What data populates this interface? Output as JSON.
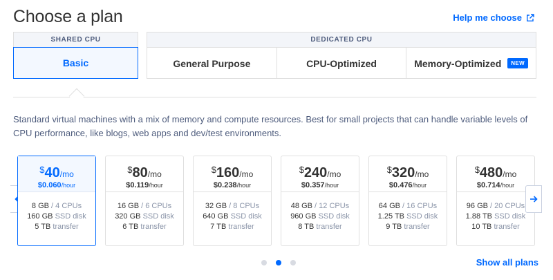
{
  "header": {
    "title": "Choose a plan",
    "help_link": "Help me choose"
  },
  "cpu_groups": {
    "shared": {
      "label": "Shared CPU",
      "tabs": [
        {
          "label": "Basic",
          "selected": true
        }
      ]
    },
    "dedicated": {
      "label": "Dedicated CPU",
      "tabs": [
        {
          "label": "General Purpose"
        },
        {
          "label": "CPU-Optimized"
        },
        {
          "label": "Memory-Optimized",
          "badge": "NEW"
        }
      ]
    }
  },
  "description": "Standard virtual machines with a mix of memory and compute resources. Best for small projects that can handle variable levels of CPU performance, like blogs, web apps and dev/test environments.",
  "plans": [
    {
      "currency": "$",
      "price": "40",
      "per_month": "/mo",
      "hourly": "$0.060",
      "per_hour": "/hour",
      "memory": "8 GB",
      "cpus": "4 CPUs",
      "disk_size": "160 GB",
      "disk_label": "SSD disk",
      "transfer": "5 TB",
      "transfer_label": "transfer",
      "selected": true
    },
    {
      "currency": "$",
      "price": "80",
      "per_month": "/mo",
      "hourly": "$0.119",
      "per_hour": "/hour",
      "memory": "16 GB",
      "cpus": "6 CPUs",
      "disk_size": "320 GB",
      "disk_label": "SSD disk",
      "transfer": "6 TB",
      "transfer_label": "transfer"
    },
    {
      "currency": "$",
      "price": "160",
      "per_month": "/mo",
      "hourly": "$0.238",
      "per_hour": "/hour",
      "memory": "32 GB",
      "cpus": "8 CPUs",
      "disk_size": "640 GB",
      "disk_label": "SSD disk",
      "transfer": "7 TB",
      "transfer_label": "transfer"
    },
    {
      "currency": "$",
      "price": "240",
      "per_month": "/mo",
      "hourly": "$0.357",
      "per_hour": "/hour",
      "memory": "48 GB",
      "cpus": "12 CPUs",
      "disk_size": "960 GB",
      "disk_label": "SSD disk",
      "transfer": "8 TB",
      "transfer_label": "transfer"
    },
    {
      "currency": "$",
      "price": "320",
      "per_month": "/mo",
      "hourly": "$0.476",
      "per_hour": "/hour",
      "memory": "64 GB",
      "cpus": "16 CPUs",
      "disk_size": "1.25 TB",
      "disk_label": "SSD disk",
      "transfer": "9 TB",
      "transfer_label": "transfer"
    },
    {
      "currency": "$",
      "price": "480",
      "per_month": "/mo",
      "hourly": "$0.714",
      "per_hour": "/hour",
      "memory": "96 GB",
      "cpus": "20 CPUs",
      "disk_size": "1.88 TB",
      "disk_label": "SSD disk",
      "transfer": "10 TB",
      "transfer_label": "transfer"
    }
  ],
  "pagination": {
    "total_pages": 3,
    "active_page": 2
  },
  "show_all_link": "Show all plans",
  "icons": {
    "external": "external-link-icon",
    "prev": "arrow-left-icon",
    "next": "arrow-right-icon"
  },
  "colors": {
    "accent": "#0069ff",
    "selected_bg": "#f3f8ff",
    "header_bg": "#f3f5f9",
    "border": "#dfdfdf",
    "muted_text": "#8a94a8"
  }
}
